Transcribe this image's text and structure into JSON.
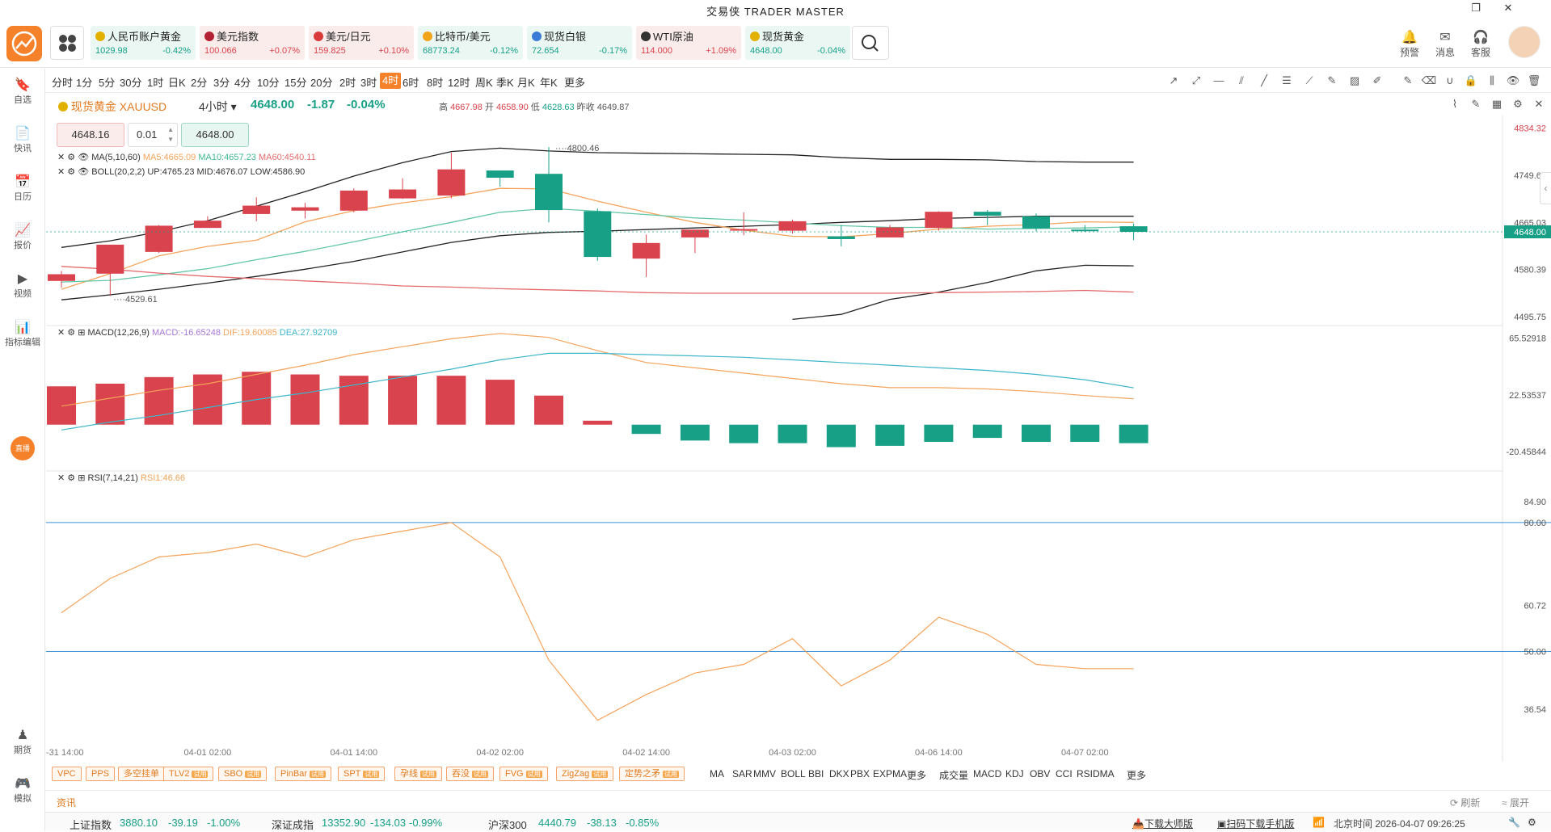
{
  "window": {
    "title": "交易侠 TRADER MASTER",
    "controls": [
      "restore-icon",
      "close-icon"
    ]
  },
  "header": {
    "quotes": [
      {
        "name": "人民币账户黄金",
        "price": "1029.98",
        "change": "-0.42%",
        "dir": "down",
        "color": "#e2b100"
      },
      {
        "name": "美元指数",
        "price": "100.066",
        "change": "+0.07%",
        "dir": "up",
        "color": "#b22234"
      },
      {
        "name": "美元/日元",
        "price": "159.825",
        "change": "+0.10%",
        "dir": "up",
        "color": "#d93a3a"
      },
      {
        "name": "比特币/美元",
        "price": "68773.24",
        "change": "-0.12%",
        "dir": "down",
        "color": "#f2a51a"
      },
      {
        "name": "现货白银",
        "price": "72.654",
        "change": "-0.17%",
        "dir": "down",
        "color": "#3a7bd5"
      },
      {
        "name": "WTI原油",
        "price": "114.000",
        "change": "+1.09%",
        "dir": "up",
        "color": "#333333"
      },
      {
        "name": "现货黄金",
        "price": "4648.00",
        "change": "-0.04%",
        "dir": "down",
        "color": "#e2b100"
      }
    ],
    "actions": [
      {
        "label": "预警",
        "icon": "bell-icon"
      },
      {
        "label": "消息",
        "icon": "mail-icon"
      },
      {
        "label": "客服",
        "icon": "headset-icon"
      }
    ]
  },
  "sidebar": {
    "items": [
      {
        "label": "自选",
        "icon": "bookmark-icon"
      },
      {
        "label": "快讯",
        "icon": "news-icon"
      },
      {
        "label": "日历",
        "icon": "calendar-icon"
      },
      {
        "label": "报价",
        "icon": "quote-icon"
      },
      {
        "label": "视频",
        "icon": "video-icon"
      },
      {
        "label": "指标编辑",
        "icon": "indicator-icon"
      }
    ],
    "live_badge": "直播",
    "bottom": [
      {
        "label": "期货",
        "icon": "futures-icon"
      },
      {
        "label": "模拟",
        "icon": "gamepad-icon"
      }
    ]
  },
  "periods": {
    "items": [
      "分时",
      "1分",
      "5分",
      "30分",
      "1时",
      "日K",
      "2分",
      "3分",
      "4分",
      "10分",
      "15分",
      "20分",
      "2时",
      "3时",
      "4时",
      "6时",
      "8时",
      "12时",
      "周K",
      "季K",
      "月K",
      "年K",
      "更多"
    ],
    "active": "4时"
  },
  "symbol": {
    "name": "现货黄金 XAUUSD",
    "period": "4小时",
    "last": "4648.00",
    "change": "-1.87",
    "pct": "-0.04%",
    "high_label": "高",
    "high": "4667.98",
    "open_label": "开",
    "open": "4658.90",
    "low_label": "低",
    "low": "4628.63",
    "prev_label": "昨收",
    "prev": "4649.87"
  },
  "trade": {
    "sell": "4648.16",
    "qty": "0.01",
    "buy": "4648.00"
  },
  "legends": {
    "ma": {
      "name": "MA(5,10,60)",
      "ma5": "MA5:4665.09",
      "ma10": "MA10:4657.23",
      "ma60": "MA60:4540.11"
    },
    "boll": {
      "name": "BOLL(20,2,2)",
      "up": "UP:4765.23",
      "mid": "MID:4676.07",
      "low": "LOW:4586.90"
    },
    "macd": {
      "name": "MACD(12,26,9)",
      "macd": "MACD:-16.65248",
      "dif": "DIF:19.60085",
      "dea": "DEA:27.92709"
    },
    "rsi": {
      "name": "RSI(7,14,21)",
      "rsi1": "RSI1:46.66"
    }
  },
  "chart_data": [
    {
      "type": "candlestick",
      "title": "现货黄金 XAUUSD 4小时",
      "y_ticks": [
        "4834.32",
        "4749.68",
        "4665.03",
        "4580.39",
        "4495.75"
      ],
      "last_price": "4648.00",
      "ylim": [
        4480,
        4845
      ],
      "annotations": {
        "high": "4800.46",
        "low": "4529.61"
      },
      "x_ticks": [
        "-31 14:00",
        "04-01 02:00",
        "04-01 14:00",
        "04-02 02:00",
        "04-02 14:00",
        "04-03 02:00",
        "04-06 14:00",
        "04-07 02:00"
      ],
      "candles": [
        {
          "o": 4560,
          "h": 4578,
          "l": 4548,
          "c": 4572
        },
        {
          "o": 4573,
          "h": 4622,
          "l": 4533,
          "c": 4625
        },
        {
          "o": 4612,
          "h": 4660,
          "l": 4610,
          "c": 4659
        },
        {
          "o": 4655,
          "h": 4676,
          "l": 4655,
          "c": 4668
        },
        {
          "o": 4680,
          "h": 4710,
          "l": 4667,
          "c": 4695
        },
        {
          "o": 4686,
          "h": 4700,
          "l": 4672,
          "c": 4692
        },
        {
          "o": 4686,
          "h": 4726,
          "l": 4683,
          "c": 4722
        },
        {
          "o": 4708,
          "h": 4744,
          "l": 4707,
          "c": 4724
        },
        {
          "o": 4713,
          "h": 4790,
          "l": 4708,
          "c": 4760
        },
        {
          "o": 4758,
          "h": 4753,
          "l": 4729,
          "c": 4745
        },
        {
          "o": 4752,
          "h": 4800,
          "l": 4665,
          "c": 4687
        },
        {
          "o": 4685,
          "h": 4690,
          "l": 4596,
          "c": 4603
        },
        {
          "o": 4600,
          "h": 4643,
          "l": 4567,
          "c": 4628
        },
        {
          "o": 4638,
          "h": 4643,
          "l": 4610,
          "c": 4652
        },
        {
          "o": 4652,
          "h": 4683,
          "l": 4642,
          "c": 4653
        },
        {
          "o": 4650,
          "h": 4670,
          "l": 4645,
          "c": 4667
        },
        {
          "o": 4640,
          "h": 4660,
          "l": 4622,
          "c": 4635
        },
        {
          "o": 4638,
          "h": 4660,
          "l": 4638,
          "c": 4656
        },
        {
          "o": 4655,
          "h": 4685,
          "l": 4650,
          "c": 4684
        },
        {
          "o": 4684,
          "h": 4687,
          "l": 4660,
          "c": 4677
        },
        {
          "o": 4676,
          "h": 4681,
          "l": 4649,
          "c": 4654
        },
        {
          "o": 4652,
          "h": 4660,
          "l": 4648,
          "c": 4651
        },
        {
          "o": 4658,
          "h": 4663,
          "l": 4633,
          "c": 4648
        }
      ],
      "series": [
        {
          "name": "BOLL UP",
          "color": "#222222",
          "values": [
            4620,
            4632,
            4648,
            4668,
            4694,
            4720,
            4748,
            4772,
            4792,
            4798,
            4793,
            4790,
            4789,
            4788,
            4787,
            4786,
            4781,
            4778,
            4778,
            4777,
            4774,
            4773,
            4773
          ]
        },
        {
          "name": "BOLL MID",
          "color": "#222222",
          "values": [
            4526,
            4535,
            4545,
            4556,
            4568,
            4581,
            4595,
            4612,
            4629,
            4641,
            4647,
            4649,
            4652,
            4655,
            4658,
            4661,
            4665,
            4668,
            4672,
            4674,
            4676,
            4676,
            4676
          ]
        },
        {
          "name": "BOLL LOW",
          "color": "#222222",
          "values": [
            null,
            null,
            null,
            null,
            null,
            null,
            null,
            null,
            null,
            null,
            null,
            null,
            null,
            null,
            null,
            4491,
            4500,
            4527,
            4540,
            4557,
            4578,
            4588,
            4587
          ]
        },
        {
          "name": "MA5",
          "color": "#f5a35b",
          "values": [
            4545,
            4573,
            4605,
            4622,
            4633,
            4666,
            4686,
            4700,
            4711,
            4726,
            4725,
            4703,
            4683,
            4665,
            4651,
            4640,
            4639,
            4645,
            4653,
            4658,
            4661,
            4666,
            4665
          ]
        },
        {
          "name": "MA10",
          "color": "#63c7a7",
          "values": [
            4558,
            4561,
            4571,
            4582,
            4598,
            4613,
            4630,
            4648,
            4665,
            4683,
            4690,
            4685,
            4679,
            4673,
            4669,
            4664,
            4659,
            4656,
            4656,
            4653,
            4654,
            4655,
            4657
          ]
        },
        {
          "name": "MA60",
          "color": "#e46b6b",
          "values": [
            4586,
            4581,
            4574,
            4568,
            4564,
            4560,
            4556,
            4551,
            4549,
            4546,
            4544,
            4542,
            4539,
            4538,
            4538,
            4538,
            4538,
            4538,
            4539,
            4540,
            4541,
            4543,
            4540
          ]
        }
      ]
    },
    {
      "type": "bar",
      "title": "MACD(12,26,9)",
      "y_ticks": [
        "65.52918",
        "22.53537",
        "-20.45844"
      ],
      "ylim": [
        -35,
        75
      ],
      "values": [
        29,
        31,
        36,
        38,
        40,
        38,
        37,
        37,
        37,
        34,
        22,
        3,
        -7,
        -12,
        -14,
        -14,
        -17,
        -16,
        -13,
        -10,
        -13,
        -13,
        -14
      ],
      "series": [
        {
          "name": "DIF",
          "color": "#f5a35b",
          "values": [
            14,
            20,
            26,
            31,
            38,
            45,
            53,
            59,
            65,
            69,
            66,
            56,
            47,
            43,
            39,
            35,
            31,
            28,
            28,
            27,
            25,
            22,
            19.6
          ]
        },
        {
          "name": "DEA",
          "color": "#3fb6c9",
          "values": [
            -4,
            2,
            7,
            13,
            19,
            24,
            30,
            36,
            42,
            49,
            54,
            54,
            53,
            52,
            51,
            49,
            47,
            45,
            43,
            41,
            38,
            34,
            27.9
          ]
        }
      ]
    },
    {
      "type": "line",
      "title": "RSI(7,14,21)",
      "y_ticks": [
        "84.90",
        "80.00",
        "60.72",
        "50.00",
        "36.54"
      ],
      "ylim": [
        30,
        92
      ],
      "series": [
        {
          "name": "RSI1",
          "color": "#f5a35b",
          "values": [
            59,
            67,
            72,
            73,
            75,
            72,
            76,
            78,
            80,
            72,
            48,
            34,
            40,
            45,
            47,
            53,
            42,
            48,
            58,
            54,
            47,
            46,
            46
          ]
        }
      ]
    }
  ],
  "indicator_tabs": {
    "custom": [
      "VPC",
      "PPS",
      "多空挂单",
      "TLV2",
      "SBO",
      "PinBar",
      "SPT",
      "孕线",
      "吞没",
      "FVG",
      "ZigZag",
      "定势之矛"
    ],
    "trial_label": "试用",
    "main": [
      "MA",
      "SAR",
      "MMV",
      "BOLL",
      "BBI",
      "DKX",
      "PBX",
      "EXPMA",
      "更多"
    ],
    "sub": [
      "成交量",
      "MACD",
      "KDJ",
      "OBV",
      "CCI",
      "RSI",
      "DMA",
      "更多"
    ]
  },
  "news": {
    "label": "资讯",
    "refresh": "刷新",
    "expand": "展开"
  },
  "statusbar": {
    "indices": [
      {
        "name": "上证指数",
        "value": "3880.10",
        "change": "-39.19",
        "pct": "-1.00%"
      },
      {
        "name": "深证成指",
        "value": "13352.90",
        "change": "-134.03",
        "pct": "-0.99%"
      },
      {
        "name": "沪深300",
        "value": "4440.79",
        "change": "-38.13",
        "pct": "-0.85%"
      }
    ],
    "download_master": "下载大师版",
    "download_mobile": "扫码下载手机版",
    "time": "北京时间 2026-04-07 09:26:25"
  },
  "colors": {
    "up": "#d9434d",
    "down": "#18a087",
    "accent": "#f5812a"
  }
}
